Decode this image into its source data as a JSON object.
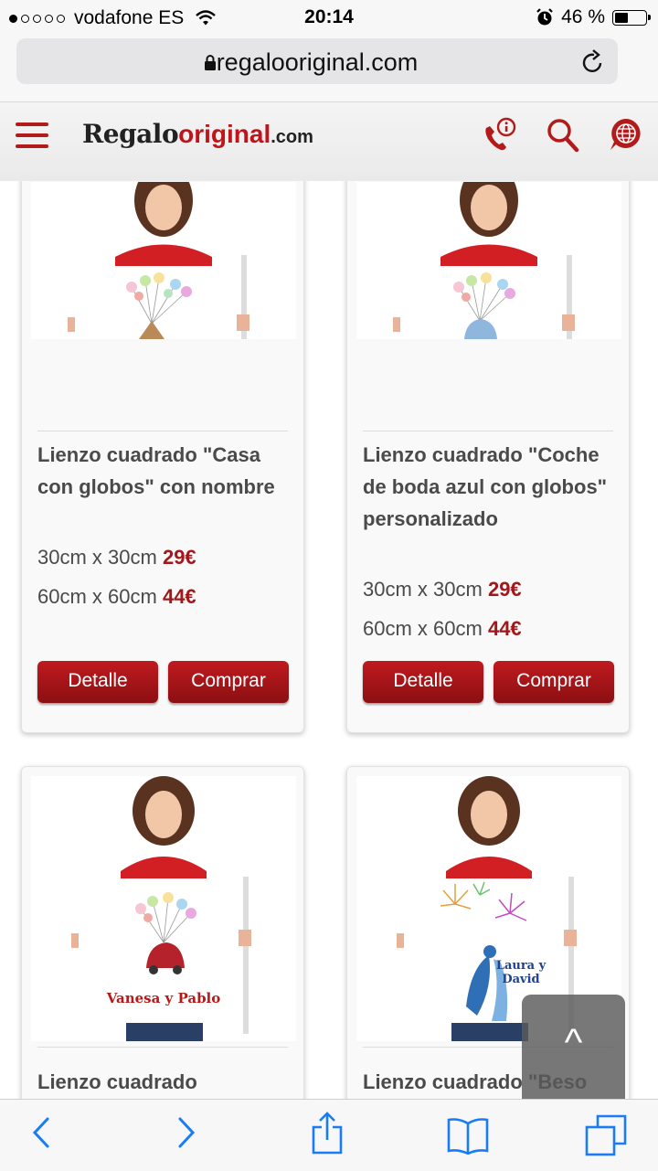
{
  "status": {
    "carrier": "vodafone ES",
    "time": "20:14",
    "battery": "46 %"
  },
  "browser": {
    "url": "regalooriginal.com"
  },
  "site": {
    "logo_part1": "Regalo",
    "logo_part2": "original",
    "logo_part3": ".com",
    "brand_color": "#b31b1b"
  },
  "products": [
    {
      "title": "Lienzo cuadrado \"Casa con globos\" con nombre",
      "sizes": [
        {
          "size": "30cm x 30cm",
          "price": "29€"
        },
        {
          "size": "60cm x 60cm",
          "price": "44€"
        }
      ],
      "detail": "Detalle",
      "buy": "Comprar"
    },
    {
      "title": "Lienzo cuadrado \"Coche de boda azul con globos\" personalizado",
      "sizes": [
        {
          "size": "30cm x 30cm",
          "price": "29€"
        },
        {
          "size": "60cm x 60cm",
          "price": "44€"
        }
      ],
      "detail": "Detalle",
      "buy": "Comprar"
    },
    {
      "title": "Lienzo cuadrado",
      "canvas_text": "Vanesa y Pablo"
    },
    {
      "title": "Lienzo cuadrado \"Beso",
      "canvas_text": "Laura y David"
    }
  ],
  "scroll_top_label": "^"
}
